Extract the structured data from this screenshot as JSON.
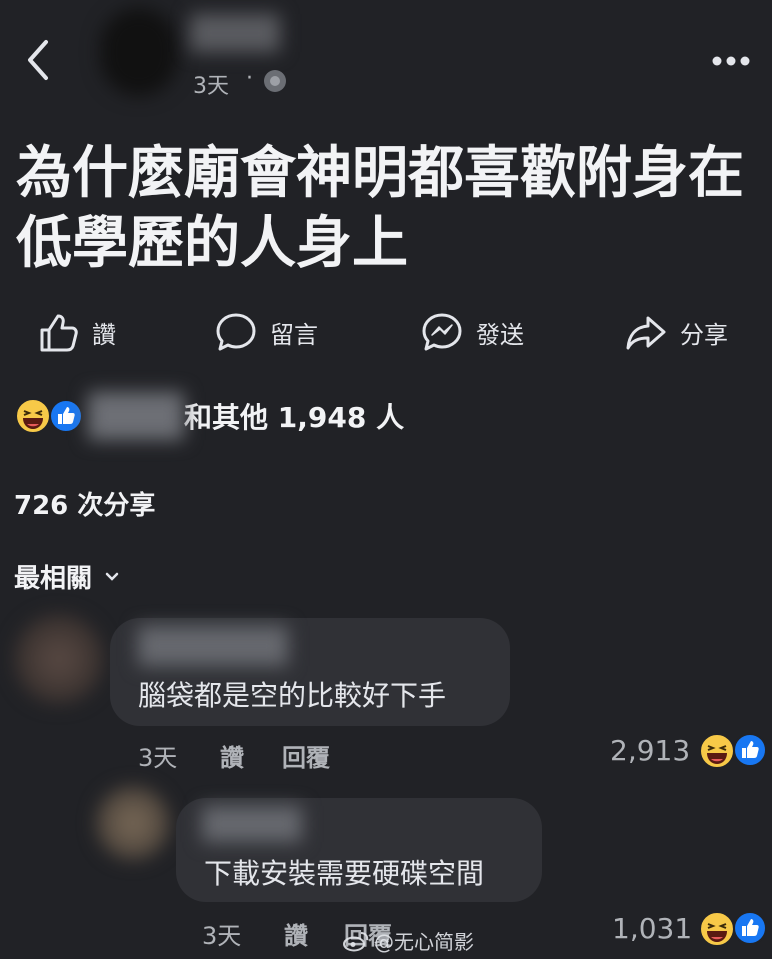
{
  "header": {
    "time": "3天",
    "separator": "·",
    "icons": {
      "back": "chevron-left-icon",
      "privacy": "globe-icon",
      "more": "more-icon"
    }
  },
  "post": {
    "title_line1": "為什麼廟會神明都喜歡附身在",
    "title_line2": "低學歷的人身上"
  },
  "actions": {
    "like": "讚",
    "comment": "留言",
    "send": "發送",
    "share": "分享"
  },
  "reactions": {
    "names": "和其他 1,948 人",
    "shares": "726 次分享",
    "icons": [
      "haha-reaction-icon",
      "like-reaction-icon"
    ]
  },
  "comments_header": {
    "label": "最相關"
  },
  "comments": [
    {
      "text": "腦袋都是空的比較好下手",
      "time": "3天",
      "like": "讚",
      "reply": "回覆",
      "count": "2,913"
    },
    {
      "text": "下載安裝需要硬碟空間",
      "time": "3天",
      "like": "讚",
      "reply": "回覆",
      "count": "1,031"
    }
  ],
  "watermark": {
    "text": "@无心简影"
  },
  "colors": {
    "background": "#212226",
    "bubble": "#303136",
    "text": "#e4e6eb",
    "muted": "#b0b3b8",
    "like_blue": "#1877f2",
    "haha_yellow": "#f7c948"
  }
}
